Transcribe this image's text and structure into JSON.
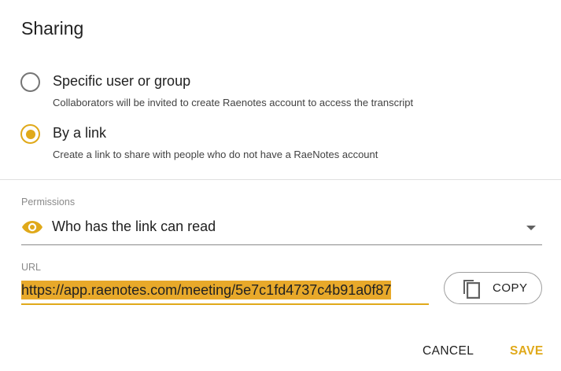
{
  "dialog": {
    "title": "Sharing"
  },
  "options": [
    {
      "label": "Specific user or group",
      "description": "Collaborators will be invited to create Raenotes account to access the transcript",
      "selected": false
    },
    {
      "label": "By a link",
      "description": "Create a link to share with people who do not have a RaeNotes account",
      "selected": true
    }
  ],
  "permissions": {
    "label": "Permissions",
    "value": "Who has the link can read",
    "icon": "eye-icon"
  },
  "url": {
    "label": "URL",
    "value": "https://app.raenotes.com/meeting/5e7c1fd4737c4b91a0f87",
    "copy_label": "COPY",
    "copy_icon": "copy-icon"
  },
  "actions": {
    "cancel_label": "CANCEL",
    "save_label": "SAVE"
  },
  "colors": {
    "accent": "#e0a91a",
    "selection": "#e8a92a"
  }
}
